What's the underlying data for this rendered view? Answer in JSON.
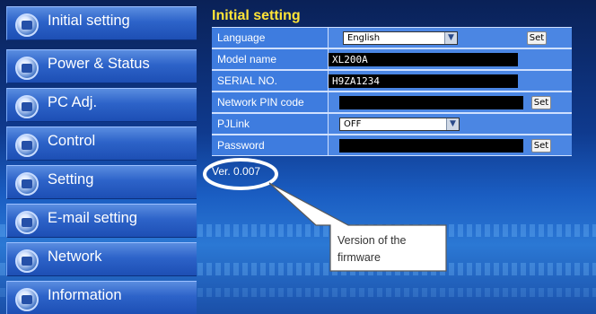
{
  "sidebar": {
    "items": [
      {
        "label": "Initial setting",
        "icon": "settings-gear-icon"
      },
      {
        "label": "Power & Status",
        "icon": "power-icon"
      },
      {
        "label": "PC Adj.",
        "icon": "pc-icon"
      },
      {
        "label": "Control",
        "icon": "control-icon"
      },
      {
        "label": "Setting",
        "icon": "wrench-icon"
      },
      {
        "label": "E-mail setting",
        "icon": "email-icon"
      },
      {
        "label": "Network",
        "icon": "network-icon"
      },
      {
        "label": "Information",
        "icon": "info-icon"
      }
    ]
  },
  "main": {
    "title": "Initial setting",
    "rows": {
      "language": {
        "label": "Language",
        "value": "English",
        "button": "Set"
      },
      "model": {
        "label": "Model name",
        "value": "XL200A"
      },
      "serial": {
        "label": "SERIAL NO.",
        "value": "H9ZA1234"
      },
      "pin": {
        "label": "Network PIN code",
        "value": "",
        "button": "Set"
      },
      "pjlink": {
        "label": "PJLink",
        "value": "OFF"
      },
      "password": {
        "label": "Password",
        "value": "",
        "button": "Set"
      }
    },
    "version": "Ver. 0.007"
  },
  "callout": {
    "line1": "Version of the",
    "line2": "firmware"
  },
  "colors": {
    "title": "#ffe437",
    "label_cell": "#3e7cdf",
    "value_cell": "#4b86e3",
    "callout_ring": "#ffffff"
  }
}
